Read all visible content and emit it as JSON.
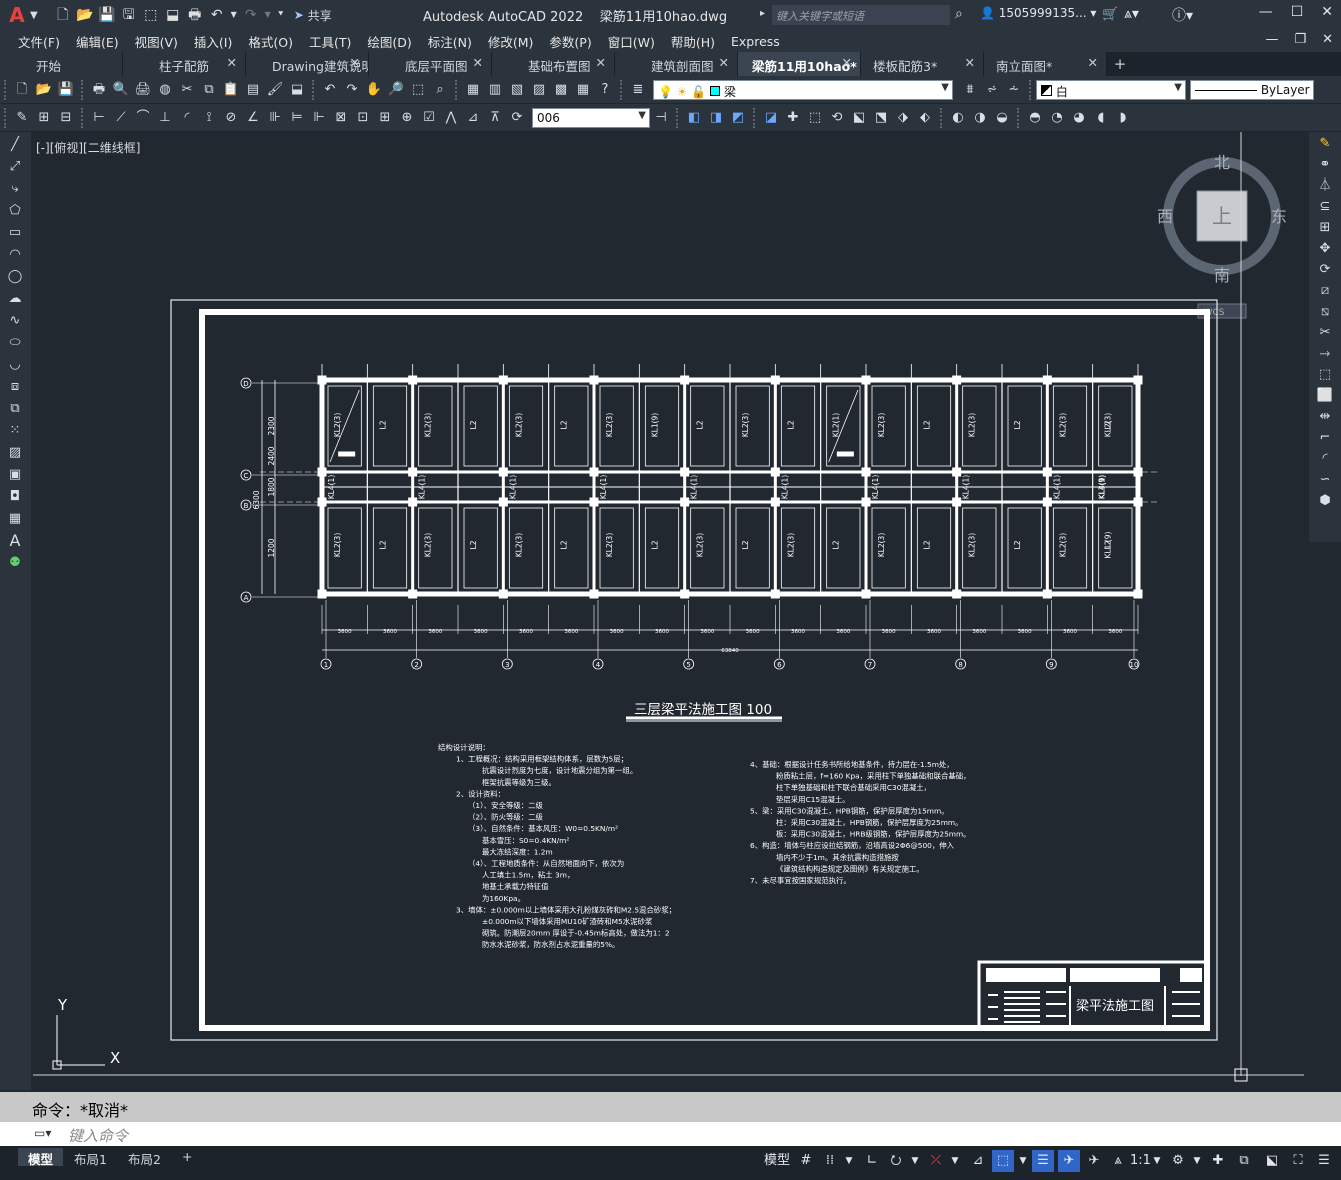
{
  "app": {
    "logo": "A",
    "title": "Autodesk AutoCAD 2022",
    "filename": "梁筋11用10hao.dwg",
    "share_label": "共享",
    "search_placeholder": "键入关键字或短语",
    "user": "1505999135..."
  },
  "menu": [
    "文件(F)",
    "编辑(E)",
    "视图(V)",
    "插入(I)",
    "格式(O)",
    "工具(T)",
    "绘图(D)",
    "标注(N)",
    "修改(M)",
    "参数(P)",
    "窗口(W)",
    "帮助(H)",
    "Express"
  ],
  "tabs": [
    {
      "label": "开始",
      "closable": false,
      "active": false
    },
    {
      "label": "柱子配筋",
      "closable": true,
      "active": false
    },
    {
      "label": "Drawing建筑说明",
      "closable": true,
      "active": false
    },
    {
      "label": "底层平面图",
      "closable": true,
      "active": false
    },
    {
      "label": "基础布置图",
      "closable": true,
      "active": false
    },
    {
      "label": "建筑剖面图",
      "closable": true,
      "active": false
    },
    {
      "label": "梁筋11用10hao*",
      "closable": true,
      "active": true
    },
    {
      "label": "楼板配筋3*",
      "closable": true,
      "active": false
    },
    {
      "label": "南立面图*",
      "closable": true,
      "active": false
    }
  ],
  "toolbar": {
    "layer_name": "梁",
    "color_value": "白",
    "linetype_value": "ByLayer",
    "textstyle_value": "006"
  },
  "viewport": {
    "label": "[-][俯视][二维线框]",
    "viewcube": {
      "north": "北",
      "south": "南",
      "east": "东",
      "west": "西",
      "top": "上",
      "wcs": "WCS"
    },
    "ucs": {
      "x": "X",
      "y": "Y"
    }
  },
  "drawing": {
    "title": "三层梁平法施工图 100",
    "titleblock_name": "梁平法施工图",
    "axes_bottom": [
      "1",
      "2",
      "3",
      "4",
      "5",
      "6",
      "7",
      "8",
      "9",
      "10"
    ],
    "axes_left": [
      "D",
      "C",
      "B",
      "A"
    ],
    "spans": [
      "3600",
      "3600",
      "3600",
      "3600",
      "3600",
      "3600",
      "3600",
      "3600",
      "3600",
      "3600",
      "3600",
      "3600",
      "3600",
      "3600",
      "3600",
      "3600",
      "3600",
      "3600"
    ],
    "total_length": "63840",
    "left_dims": [
      "2300",
      "2400",
      "1800",
      "1200",
      "6300"
    ],
    "beam_labels_top": [
      "KL2(3)",
      "L2",
      "KL2(3)",
      "L2",
      "KL2(3)",
      "L2",
      "KL2(3)",
      "KL1(9)",
      "L2",
      "KL2(3)",
      "L2",
      "KL2(1)",
      "KL2(3)",
      "L2",
      "KL2(3)",
      "L2",
      "KL2(3)",
      "L2",
      "KL2(3)"
    ],
    "beam_labels_mid": [
      "KL4(1)",
      "KL4(1)",
      "KL4(1)",
      "KL4(1)",
      "KL4(1)",
      "KL4(1)",
      "KL4(1)",
      "KL4(1)",
      "KL4(1)",
      "KL4(1)",
      "KL3(9)",
      "KL3(9)"
    ],
    "beam_labels_bot": [
      "KL2(3)",
      "L2",
      "KL2(3)",
      "L2",
      "KL2(3)",
      "L2",
      "KL2(3)",
      "L2",
      "KL2(3)",
      "L2",
      "KL2(3)",
      "L2",
      "KL2(3)",
      "L2",
      "KL2(3)",
      "L2",
      "KL2(3)",
      "L2",
      "KL1 (9)"
    ],
    "notes_left": [
      "结构设计说明：",
      "1、工程概况：结构采用框架结构体系，层数为5层；",
      "抗震设计烈度为七度，设计地震分组为第一组。",
      "框架抗震等级为三级。",
      "2、设计资料：",
      "（1）、安全等级：二级",
      "（2）、防火等级：二级",
      "（3）、自然条件：基本风压：W0=0.5KN/m²",
      "基本雪压：S0=0.4KN/m²",
      "最大冻结深度：1.2m",
      "（4）、工程地质条件：从自然地面向下，依次为",
      "人工填土1.5m，粘土 3m，",
      "地基土承载力特征值",
      "为160Kpa。",
      "3、墙体：±0.000m以上墙体采用大孔粉煤灰砖和M2.5混合砂浆；",
      "±0.000m以下墙体采用MU10矿渣砖和M5水泥砂浆",
      "砌筑。防潮层20mm 厚设于-0.45m标高处，做法为1：2",
      "防水水泥砂浆，防水剂占水泥重量的5%。"
    ],
    "notes_right": [
      "4、基础：根据设计任务书所给地基条件，持力层在-1.5m处，",
      "粉质粘土层，f=160 Kpa，采用柱下单独基础和联合基础，",
      "柱下单独基础和柱下联合基础采用C30混凝土，",
      "垫层采用C15混凝土。",
      "5、梁：采用C30混凝土，HPB钢筋，保护层厚度为15mm。",
      "柱：采用C30混凝土，HPB钢筋，保护层厚度为25mm。",
      "板：采用C30混凝土，HRB级钢筋，保护层厚度为25mm。",
      "6、构造：墙体与柱应设拉结钢筋，沿墙高设2Φ6@500，伸入",
      "墙内不少于1m。其余抗震构造措施按",
      "《建筑结构构造规定及图例》有关规定施工。",
      "7、未尽事宜按国家规范执行。"
    ]
  },
  "command": {
    "history": "命令：*取消*",
    "placeholder": "键入命令"
  },
  "layout_tabs": [
    "模型",
    "布局1",
    "布局2"
  ],
  "status": {
    "model_label": "模型",
    "scale": "1:1"
  }
}
